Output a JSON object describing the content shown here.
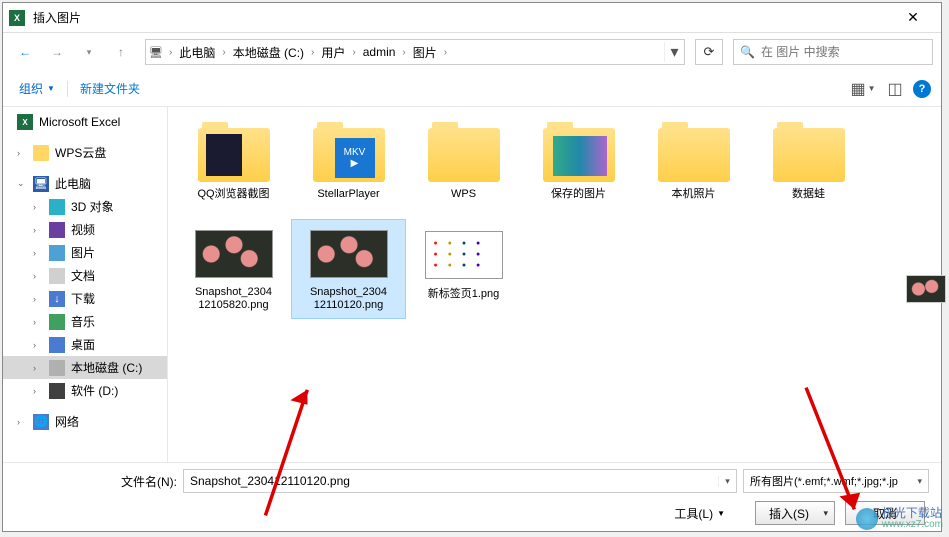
{
  "title": "插入图片",
  "nav": {
    "back": "←",
    "fwd": "→",
    "up": "↑"
  },
  "breadcrumb": {
    "segs": [
      "此电脑",
      "本地磁盘 (C:)",
      "用户",
      "admin",
      "图片"
    ]
  },
  "search_placeholder": "在 图片 中搜索",
  "toolbar": {
    "organize": "组织",
    "newfolder": "新建文件夹"
  },
  "sidebar": {
    "excel": "Microsoft Excel",
    "wps": "WPS云盘",
    "pc": "此电脑",
    "obj3d": "3D 对象",
    "video": "视频",
    "img": "图片",
    "doc": "文档",
    "dl": "下载",
    "music": "音乐",
    "desktop": "桌面",
    "drivec": "本地磁盘 (C:)",
    "drived": "软件 (D:)",
    "net": "网络"
  },
  "items": {
    "qq": "QQ浏览器截图",
    "stellar": "StellarPlayer",
    "wps": "WPS",
    "saved": "保存的图片",
    "local": "本机照片",
    "frog": "数据蛙",
    "snap1a": "Snapshot_2304",
    "snap1b": "12105820.png",
    "snap2a": "Snapshot_2304",
    "snap2b": "12110120.png",
    "newtab": "新标签页1.png"
  },
  "bottom": {
    "filename_label": "文件名(N):",
    "filename_value": "Snapshot_230412110120.png",
    "filter": "所有图片(*.emf;*.wmf;*.jpg;*.jp",
    "tools": "工具(L)",
    "insert": "插入(S)",
    "cancel": "取消"
  },
  "watermark": {
    "name": "极光下载站",
    "url": "www.xz7.com"
  }
}
